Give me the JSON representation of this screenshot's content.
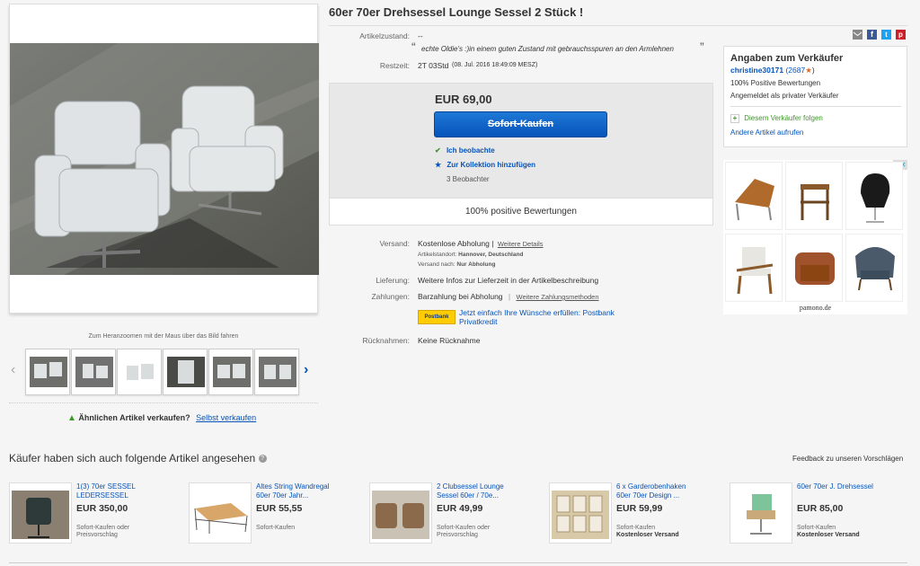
{
  "listing": {
    "title": "60er 70er Drehsessel Lounge Sessel 2 Stück !"
  },
  "gallery": {
    "zoom_hint": "Zum Heranzoomen mit der Maus über das Bild fahren",
    "thumbnail_count": 6
  },
  "sell_similar": {
    "text": "Ähnlichen Artikel verkaufen?",
    "link": "Selbst verkaufen"
  },
  "details": {
    "condition_label": "Artikelzustand:",
    "condition_value": "--",
    "quote": "echte Oldie's :)in einem guten Zustand mit gebrauchsspuren an den Armlehnen",
    "time_label": "Restzeit:",
    "time_value": "2T 03Std",
    "time_detail": "(08. Jul. 2016   18:49:09 MESZ)"
  },
  "buybox": {
    "price": "EUR 69,00",
    "buy_button": "Sofort-Kaufen",
    "watching": "Ich beobachte",
    "add_collection": "Zur Kollektion hinzufügen",
    "watchers": "3 Beobachter",
    "feedback": "100% positive Bewertungen"
  },
  "shipping": {
    "label": "Versand:",
    "value": "Kostenlose Abholung |",
    "more_link": "Weitere Details",
    "location_label": "Artikelstandort:",
    "location_value": "Hannover, Deutschland",
    "shipto_label": "Versand nach:",
    "shipto_value": "Nur Abholung",
    "delivery_label": "Lieferung:",
    "delivery_value": "Weitere Infos zur Lieferzeit in der Artikelbeschreibung",
    "payment_label": "Zahlungen:",
    "payment_value": "Barzahlung bei Abholung",
    "payment_link": "Weitere Zahlungsmethoden",
    "postbank_logo": "Postbank",
    "postbank_text": "Jetzt einfach Ihre Wünsche erfüllen: Postbank Privatkredit",
    "returns_label": "Rücknahmen:",
    "returns_value": "Keine Rücknahme"
  },
  "seller": {
    "heading": "Angaben zum Verkäufer",
    "name": "christine30171",
    "score": "(2687",
    "score_close": ")",
    "positive": "100% Positive Bewertungen",
    "registered": "Angemeldet als privater Verkäufer",
    "follow": "Diesem Verkäufer folgen",
    "other_items": "Andere Artikel aufrufen"
  },
  "ad": {
    "brand": "pamono.de"
  },
  "recommendations": {
    "heading": "Käufer haben sich auch folgende Artikel angesehen",
    "feedback": "Feedback zu unseren Vorschlägen",
    "items": [
      {
        "title": "1(3) 70er SESSEL LEDERSESSEL",
        "price": "EUR 350,00",
        "ship1": "Sofort-Kaufen oder",
        "ship2": "Preisvorschlag"
      },
      {
        "title": "Altes String Wandregal 60er 70er Jahr...",
        "price": "EUR 55,55",
        "ship1": "Sofort-Kaufen",
        "ship2": ""
      },
      {
        "title": "2 Clubsessel Lounge Sessel 60er / 70e...",
        "price": "EUR 49,99",
        "ship1": "Sofort-Kaufen oder",
        "ship2": "Preisvorschlag"
      },
      {
        "title": "6 x Garderobenhaken 60er 70er Design ...",
        "price": "EUR 59,99",
        "ship1": "Sofort-Kaufen",
        "ship2": "Kostenloser Versand"
      },
      {
        "title": "60er 70er J. Drehsessel",
        "price": "EUR 85,00",
        "ship1": "Sofort-Kaufen",
        "ship2": "Kostenloser Versand"
      }
    ]
  },
  "colors": {
    "link": "#0654ba",
    "button": "#0654ba",
    "follow_green": "#3a9a26",
    "star": "#e3661f"
  },
  "icons": [
    "email-icon",
    "facebook-icon",
    "twitter-icon",
    "pinterest-icon",
    "check-icon",
    "star-icon",
    "plus-icon",
    "tag-icon",
    "info-icon",
    "adchoices-icon"
  ]
}
